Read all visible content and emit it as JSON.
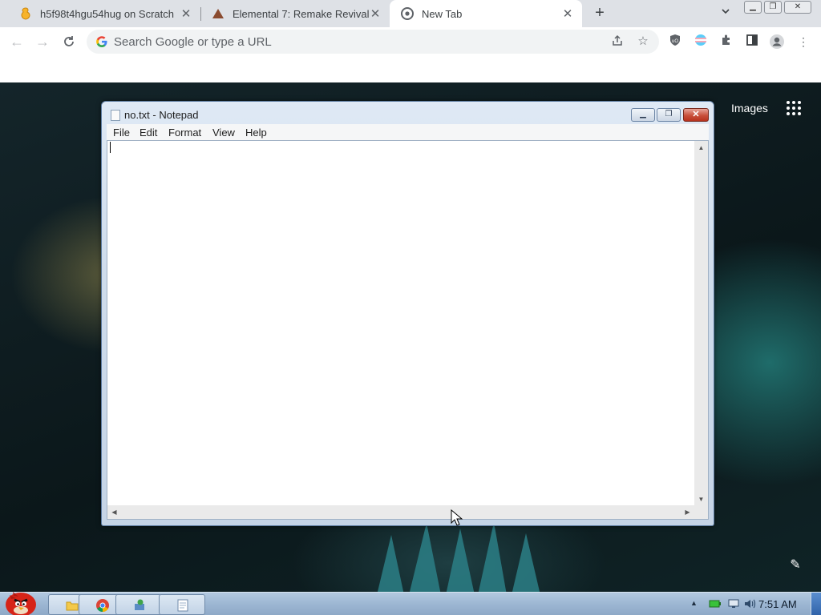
{
  "browser": {
    "tabs": [
      {
        "title": "h5f98t4hgu54hug on Scratch",
        "icon": "scratch-cat-icon",
        "active": false
      },
      {
        "title": "Elemental 7: Remake Revival",
        "icon": "mountain-icon",
        "active": false
      },
      {
        "title": "New Tab",
        "icon": "chrome-icon",
        "active": true
      }
    ],
    "omnibox_placeholder": "Search Google or type a URL"
  },
  "page": {
    "links": [
      "Images"
    ],
    "colors": {
      "accent": "#1a73e8",
      "background": "#0d1b1e"
    }
  },
  "notepad": {
    "title": "no.txt - Notepad",
    "menus": [
      "File",
      "Edit",
      "Format",
      "View",
      "Help"
    ],
    "text": ""
  },
  "taskbar": {
    "clock": "7:51 AM",
    "pinned": [
      "explorer-icon",
      "chrome-icon",
      "network-app-icon",
      "notepad-icon"
    ]
  }
}
